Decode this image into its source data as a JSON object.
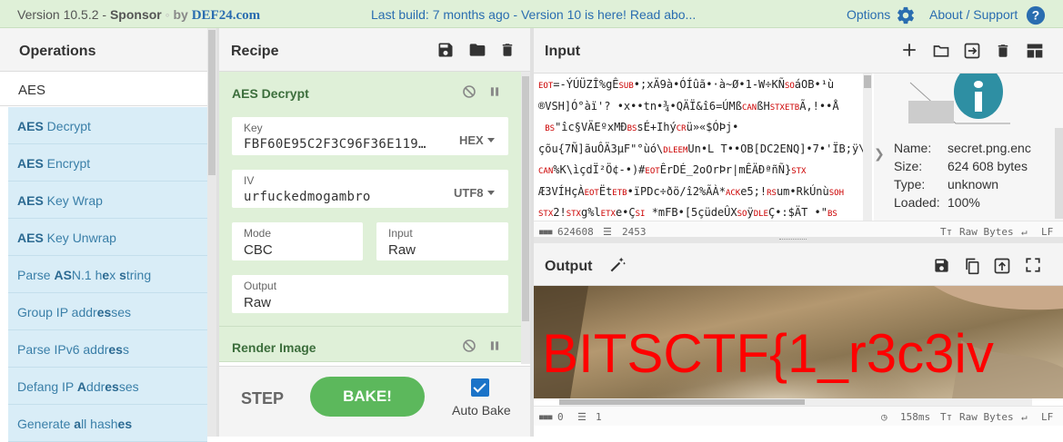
{
  "banner": {
    "version_prefix": "Version 10.5.2 - ",
    "sponsored": "Sponsor",
    "by": "by",
    "sponsor_name": "DEF24.com",
    "build_text": "Last build: 7 months ago - Version 10 is here! Read abo...",
    "options_label": "Options",
    "about_label": "About / Support"
  },
  "operations": {
    "title": "Operations",
    "search_value": "AES",
    "items": [
      {
        "pre": "",
        "bold": "AES",
        "post": " Decrypt"
      },
      {
        "pre": "",
        "bold": "AES",
        "post": " Encrypt"
      },
      {
        "pre": "",
        "bold": "AES",
        "post": " Key Wrap"
      },
      {
        "pre": "",
        "bold": "AES",
        "post": " Key Unwrap"
      },
      {
        "pre": "Parse ",
        "bold": "AS",
        "post": "N.1 h",
        "bold2": "e",
        "post2": "x ",
        "bold3": "s",
        "post3": "tring"
      },
      {
        "pre": "Group IP addr",
        "bold": "es",
        "post": "ses"
      },
      {
        "pre": "Parse IPv6 addr",
        "bold": "es",
        "post": "s"
      },
      {
        "pre": "Defang IP ",
        "bold": "A",
        "post": "ddr",
        "bold2": "es",
        "post2": "ses"
      },
      {
        "pre": "Generate ",
        "bold": "a",
        "post": "ll hash",
        "bold2": "es",
        "post2": ""
      }
    ]
  },
  "recipe": {
    "title": "Recipe",
    "op1": {
      "name": "AES Decrypt",
      "key_label": "Key",
      "key_value": "FBF60E95C2F3C96F36E119…",
      "key_format": "HEX",
      "iv_label": "IV",
      "iv_value": "urfuckedmogambro",
      "iv_format": "UTF8",
      "mode_label": "Mode",
      "mode_value": "CBC",
      "input_label": "Input",
      "input_value": "Raw",
      "output_label": "Output",
      "output_value": "Raw"
    },
    "op2": {
      "name": "Render Image"
    },
    "step_label": "STEP",
    "bake_label": "BAKE!",
    "auto_bake_label": "Auto Bake",
    "auto_bake_checked": true
  },
  "input": {
    "title": "Input",
    "lines": [
      "[EOT]=-ÝÚÜZÎ%gÊ[SUB]•;xÄ9à•ÓÍûã•·à~Ø•1-W÷KÑ[SO]áOB•¹ù",
      "®VSH]Ó°àï'? •x••tn•¾•QÄÏ&î6=ÚMß[CAN]ßH[STXETB]Ã,!••Å",
      " [BS]\"îc§VÄEºxMÐ[BS]sÉ+Ihý[CR]ü»«$ÓÞj•",
      "çõu{7Ñ]ãuÔÄ3µF\"°ùó\\[DLE EM]Un•L T••OB[DC2ENQ]•7•'ÏB;ÿ\\",
      "[CAN]%K\\ìçdÏ²Ö¢-•)#[EOT]ÊrDÉ_2oOrÞr|mÊÄÐªñÑ}[STX]",
      "Æ3VÍHçÀ[EOT]Ët[ETB]•ïPDc÷ðö/î2%ÃÀ*[ACK]e5;![RS]um•RkÚnù[SOH]",
      "[STX]2![STX]g%l[ETX]e•Ç[SI] *mFB•[5çüdeÛX[SO]ÿ[DLE]Ç•:$ÄT •\"[BS]",
      "ÿ¨©:°|N2NOàd-À•z$àM#ÂÛ[FS]_À•øp[SUB]•g[ACK]8+4[SUBETX]©¥[SOH]"
    ],
    "file": {
      "name_label": "Name:",
      "name_value": "secret.png.enc",
      "size_label": "Size:",
      "size_value": "624 608 bytes",
      "type_label": "Type:",
      "type_value": "unknown",
      "loaded_label": "Loaded:",
      "loaded_value": "100%"
    },
    "status": {
      "chars": "624608",
      "lines": "2453",
      "encoding": "Raw Bytes",
      "eol": "LF"
    }
  },
  "output": {
    "title": "Output",
    "flag_text": "BITSCTF{1_r3c3iv",
    "status": {
      "chars": "0",
      "lines": "1",
      "time": "158ms",
      "encoding": "Raw Bytes",
      "eol": "LF"
    }
  }
}
